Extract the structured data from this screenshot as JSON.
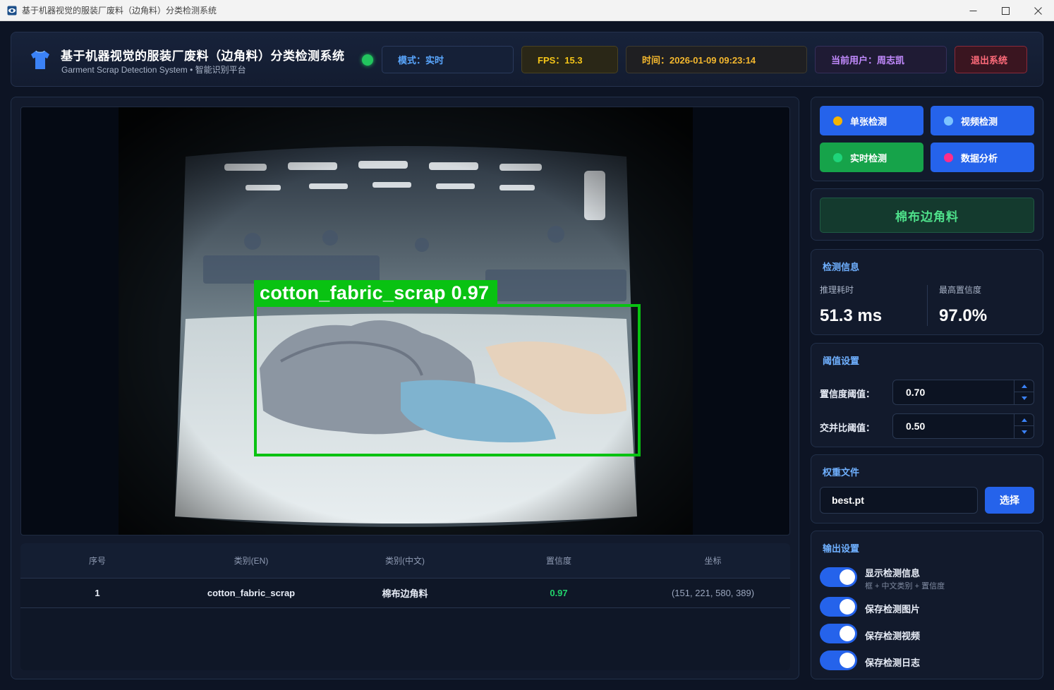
{
  "window": {
    "title": "基于机器视觉的服装厂废料（边角料）分类检测系统"
  },
  "header": {
    "title": "基于机器视觉的服装厂废料（边角料）分类检测系统",
    "subtitle": "Garment Scrap Detection System • 智能识别平台",
    "status_color": "#22c55e",
    "mode": "模式：实时",
    "fps": "FPS：15.3",
    "time": "时间：2026-01-09 09:23:14",
    "user": "当前用户：周志凯",
    "exit_label": "退出系统"
  },
  "detection_overlay": {
    "label": "cotton_fabric_scrap  0.97",
    "color": "#09c212"
  },
  "table": {
    "headers": [
      "序号",
      "类别(EN)",
      "类别(中文)",
      "置信度",
      "坐标"
    ],
    "rows": [
      {
        "index": "1",
        "class_en": "cotton_fabric_scrap",
        "class_cn": "棉布边角料",
        "confidence": "0.97",
        "coords": "(151, 221, 580, 389)"
      }
    ]
  },
  "modes": [
    {
      "label": "单张检测",
      "dot_color": "#f5b400"
    },
    {
      "label": "视频检测",
      "dot_color": "#7cc4ff"
    },
    {
      "label": "实时检测",
      "dot_color": "#1fd47a"
    },
    {
      "label": "数据分析",
      "dot_color": "#ff2d8a"
    }
  ],
  "current_class": "棉布边角料",
  "detection_info": {
    "title": "检测信息",
    "inference_label": "推理耗时",
    "inference_value": "51.3 ms",
    "max_conf_label": "最高置信度",
    "max_conf_value": "97.0%"
  },
  "thresholds": {
    "title": "阈值设置",
    "conf_label": "置信度阈值：",
    "conf_value": "0.70",
    "iou_label": "交并比阈值：",
    "iou_value": "0.50"
  },
  "weights": {
    "title": "权重文件",
    "file": "best.pt",
    "select_label": "选择"
  },
  "output": {
    "title": "输出设置",
    "options": [
      {
        "label": "显示检测信息",
        "sub": "框 + 中文类别 + 置信度",
        "on": true
      },
      {
        "label": "保存检测图片",
        "on": true
      },
      {
        "label": "保存检测视频",
        "on": true
      },
      {
        "label": "保存检测日志",
        "on": true
      }
    ]
  }
}
